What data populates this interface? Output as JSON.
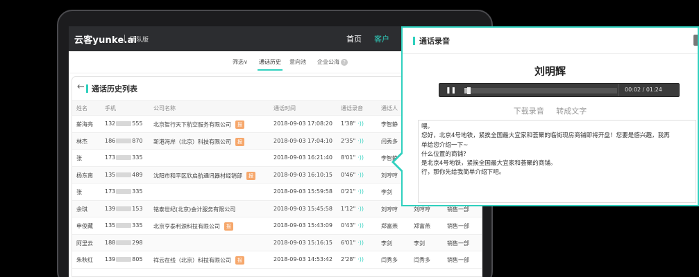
{
  "app": {
    "logo": "云客yunke.ai",
    "edition": "团队版"
  },
  "nav": {
    "home": "首页",
    "customer": "客户"
  },
  "subtabs": [
    {
      "label": "筛选",
      "suffix": "∨"
    },
    {
      "label": "通话历史"
    },
    {
      "label": "意向池"
    },
    {
      "label": "企业公海",
      "suffix": "?"
    }
  ],
  "list": {
    "title": "通话历史列表",
    "columns": [
      "姓名",
      "手机",
      "公司名称",
      "通话时间",
      "通话录音",
      "通话人"
    ],
    "tag_label": "报",
    "rows": [
      {
        "name": "薪海亮",
        "phone_pre": "132",
        "phone_suf": "555",
        "company": "北京智行天下航空服务有限公司",
        "tag": true,
        "time": "2018-09-03 17:08:20",
        "duration": "1'38\"",
        "caller": "李智静",
        "caller2": "",
        "dept": ""
      },
      {
        "name": "林杰",
        "phone_pre": "186",
        "phone_suf": "870",
        "company": "新港海岸（北京）科技有限公司",
        "tag": true,
        "time": "2018-09-03 17:04:10",
        "duration": "2'35\"",
        "caller": "闫秀多",
        "caller2": "",
        "dept": ""
      },
      {
        "name": "张",
        "phone_pre": "173",
        "phone_suf": "335",
        "company": "",
        "tag": false,
        "time": "2018-09-03 16:21:40",
        "duration": "8'01\"",
        "caller": "李智静",
        "caller2": "",
        "dept": ""
      },
      {
        "name": "杨东南",
        "phone_pre": "135",
        "phone_suf": "489",
        "company": "沈阳市和平区欣启航通讯器材经销部",
        "tag": true,
        "time": "2018-09-03 16:10:15",
        "duration": "0'46\"",
        "caller": "刘哼哼",
        "caller2": "",
        "dept": ""
      },
      {
        "name": "张",
        "phone_pre": "173",
        "phone_suf": "335",
        "company": "",
        "tag": false,
        "time": "2018-09-03 15:59:58",
        "duration": "0'21\"",
        "caller": "李剑",
        "caller2": "",
        "dept": ""
      },
      {
        "name": "余琪",
        "phone_pre": "139",
        "phone_suf": "153",
        "company": "铭泰世纪(北京)会计服务有限公司",
        "tag": false,
        "time": "2018-09-03 15:45:58",
        "duration": "1'12\"",
        "caller": "刘哼哼",
        "caller2": "刘哼哼",
        "dept": "销售一部"
      },
      {
        "name": "申俊藏",
        "phone_pre": "135",
        "phone_suf": "335",
        "company": "北京亨泰利源科技有限公司",
        "tag": true,
        "time": "2018-09-03 15:43:09",
        "duration": "0'43\"",
        "caller": "郑富燕",
        "caller2": "郑富燕",
        "dept": "销售一部"
      },
      {
        "name": "阿里云",
        "phone_pre": "188",
        "phone_suf": "298",
        "company": "",
        "tag": false,
        "time": "2018-09-03 15:16:15",
        "duration": "6'01\"",
        "caller": "李剑",
        "caller2": "李剑",
        "dept": "销售一部"
      },
      {
        "name": "朱秋红",
        "phone_pre": "139",
        "phone_suf": "805",
        "company": "祥云在线（北京）科技有限公司",
        "tag": true,
        "time": "2018-09-03 14:53:42",
        "duration": "2'28\"",
        "caller": "闫秀多",
        "caller2": "闫秀多",
        "dept": "销售一部"
      }
    ]
  },
  "recording": {
    "title": "通话录音",
    "caller_name": "刘明辉",
    "time_display": "00:02 / 01:24",
    "progress_fraction": 0.025,
    "download_label": "下载录音",
    "transcribe_label": "转成文字",
    "transcript": [
      "喂。",
      "您好，北京4号地铁，紧挨全国最大宜家和荟聚的临街现房商铺即将开盘！您要是感兴趣，我再",
      "单给您介绍一下~",
      "什么位置的商铺？",
      "是北京4号地铁，紧挨全国最大宜家和荟聚的商铺。",
      "行，那你先给我简单介绍下吧。"
    ]
  }
}
